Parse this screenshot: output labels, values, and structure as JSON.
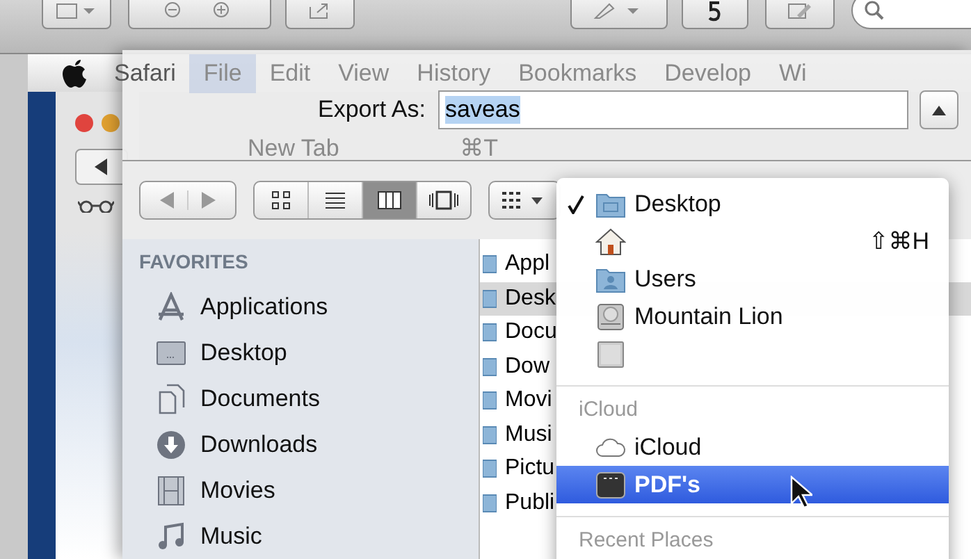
{
  "menu_bar": [
    {
      "label": "Safari",
      "selected": false
    },
    {
      "label": "File",
      "selected": true
    },
    {
      "label": "Edit",
      "selected": false
    },
    {
      "label": "View",
      "selected": false
    },
    {
      "label": "History",
      "selected": false
    },
    {
      "label": "Bookmarks",
      "selected": false
    },
    {
      "label": "Develop",
      "selected": false
    },
    {
      "label": "Wi",
      "selected": false
    }
  ],
  "file_menu": [
    {
      "label": "New Tab",
      "shortcut": "⌘T"
    }
  ],
  "sheet": {
    "export_as": {
      "label": "Export As:",
      "value": "saveas",
      "highlighted": true
    },
    "view_modes": [
      {
        "kind": "icons",
        "selected": false
      },
      {
        "kind": "list",
        "selected": false
      },
      {
        "kind": "columns",
        "selected": true
      },
      {
        "kind": "coverflow",
        "selected": false
      }
    ],
    "sidebar": {
      "heading": "FAVORITES",
      "items": [
        {
          "kind": "applications",
          "label": "Applications"
        },
        {
          "kind": "desktop",
          "label": "Desktop"
        },
        {
          "kind": "documents",
          "label": "Documents"
        },
        {
          "kind": "downloads",
          "label": "Downloads"
        },
        {
          "kind": "movies",
          "label": "Movies"
        },
        {
          "kind": "music",
          "label": "Music"
        }
      ]
    },
    "column": [
      {
        "label": "Appl",
        "selected": false
      },
      {
        "label": "Desk",
        "selected": true
      },
      {
        "label": "Docu",
        "selected": false
      },
      {
        "label": "Dow",
        "selected": false
      },
      {
        "label": "Movi",
        "selected": false
      },
      {
        "label": "Musi",
        "selected": false
      },
      {
        "label": "Pictu",
        "selected": false
      },
      {
        "label": "Publi",
        "selected": false
      }
    ]
  },
  "location_menu": [
    {
      "kind": "folder",
      "label": "Desktop",
      "checked": true,
      "selected": false
    },
    {
      "kind": "home",
      "shortcut": "⇧⌘H",
      "checked": false,
      "selected": false
    },
    {
      "kind": "users",
      "label": "Users",
      "checked": false,
      "selected": false
    },
    {
      "kind": "disk",
      "label": "Mountain Lion",
      "checked": false,
      "selected": false
    },
    {
      "kind": "computer",
      "checked": false,
      "selected": false
    },
    {
      "kind": "separator"
    },
    {
      "kind": "header",
      "label": "iCloud"
    },
    {
      "kind": "cloud",
      "label": "iCloud",
      "checked": false,
      "selected": false
    },
    {
      "kind": "app",
      "label": "PDF's",
      "checked": false,
      "selected": true
    },
    {
      "kind": "separator"
    },
    {
      "kind": "header",
      "label": "Recent Places"
    }
  ]
}
